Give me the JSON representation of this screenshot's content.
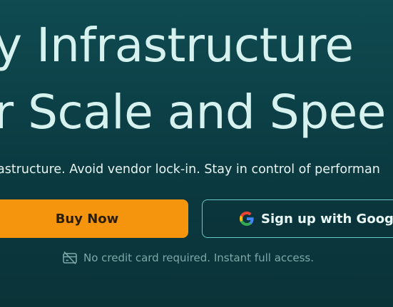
{
  "hero": {
    "headline_line1": "y Infrastructure",
    "headline_line2": "r Scale and Spee",
    "subtext": "astructure. Avoid vendor lock-in. Stay in control of performan"
  },
  "cta": {
    "buy_label": "Buy Now",
    "google_label": "Sign up with Google",
    "google_icon": "google-g-icon"
  },
  "note": {
    "icon": "credit-card-off-icon",
    "text": "No credit card required. Instant full access."
  },
  "colors": {
    "background_top": "#0f4b51",
    "background_bottom": "#0a3338",
    "headline": "#d6f1ee",
    "buy_button": "#f5950e",
    "google_button_border": "#6bc8c7",
    "note_text": "#7fa7a8"
  }
}
